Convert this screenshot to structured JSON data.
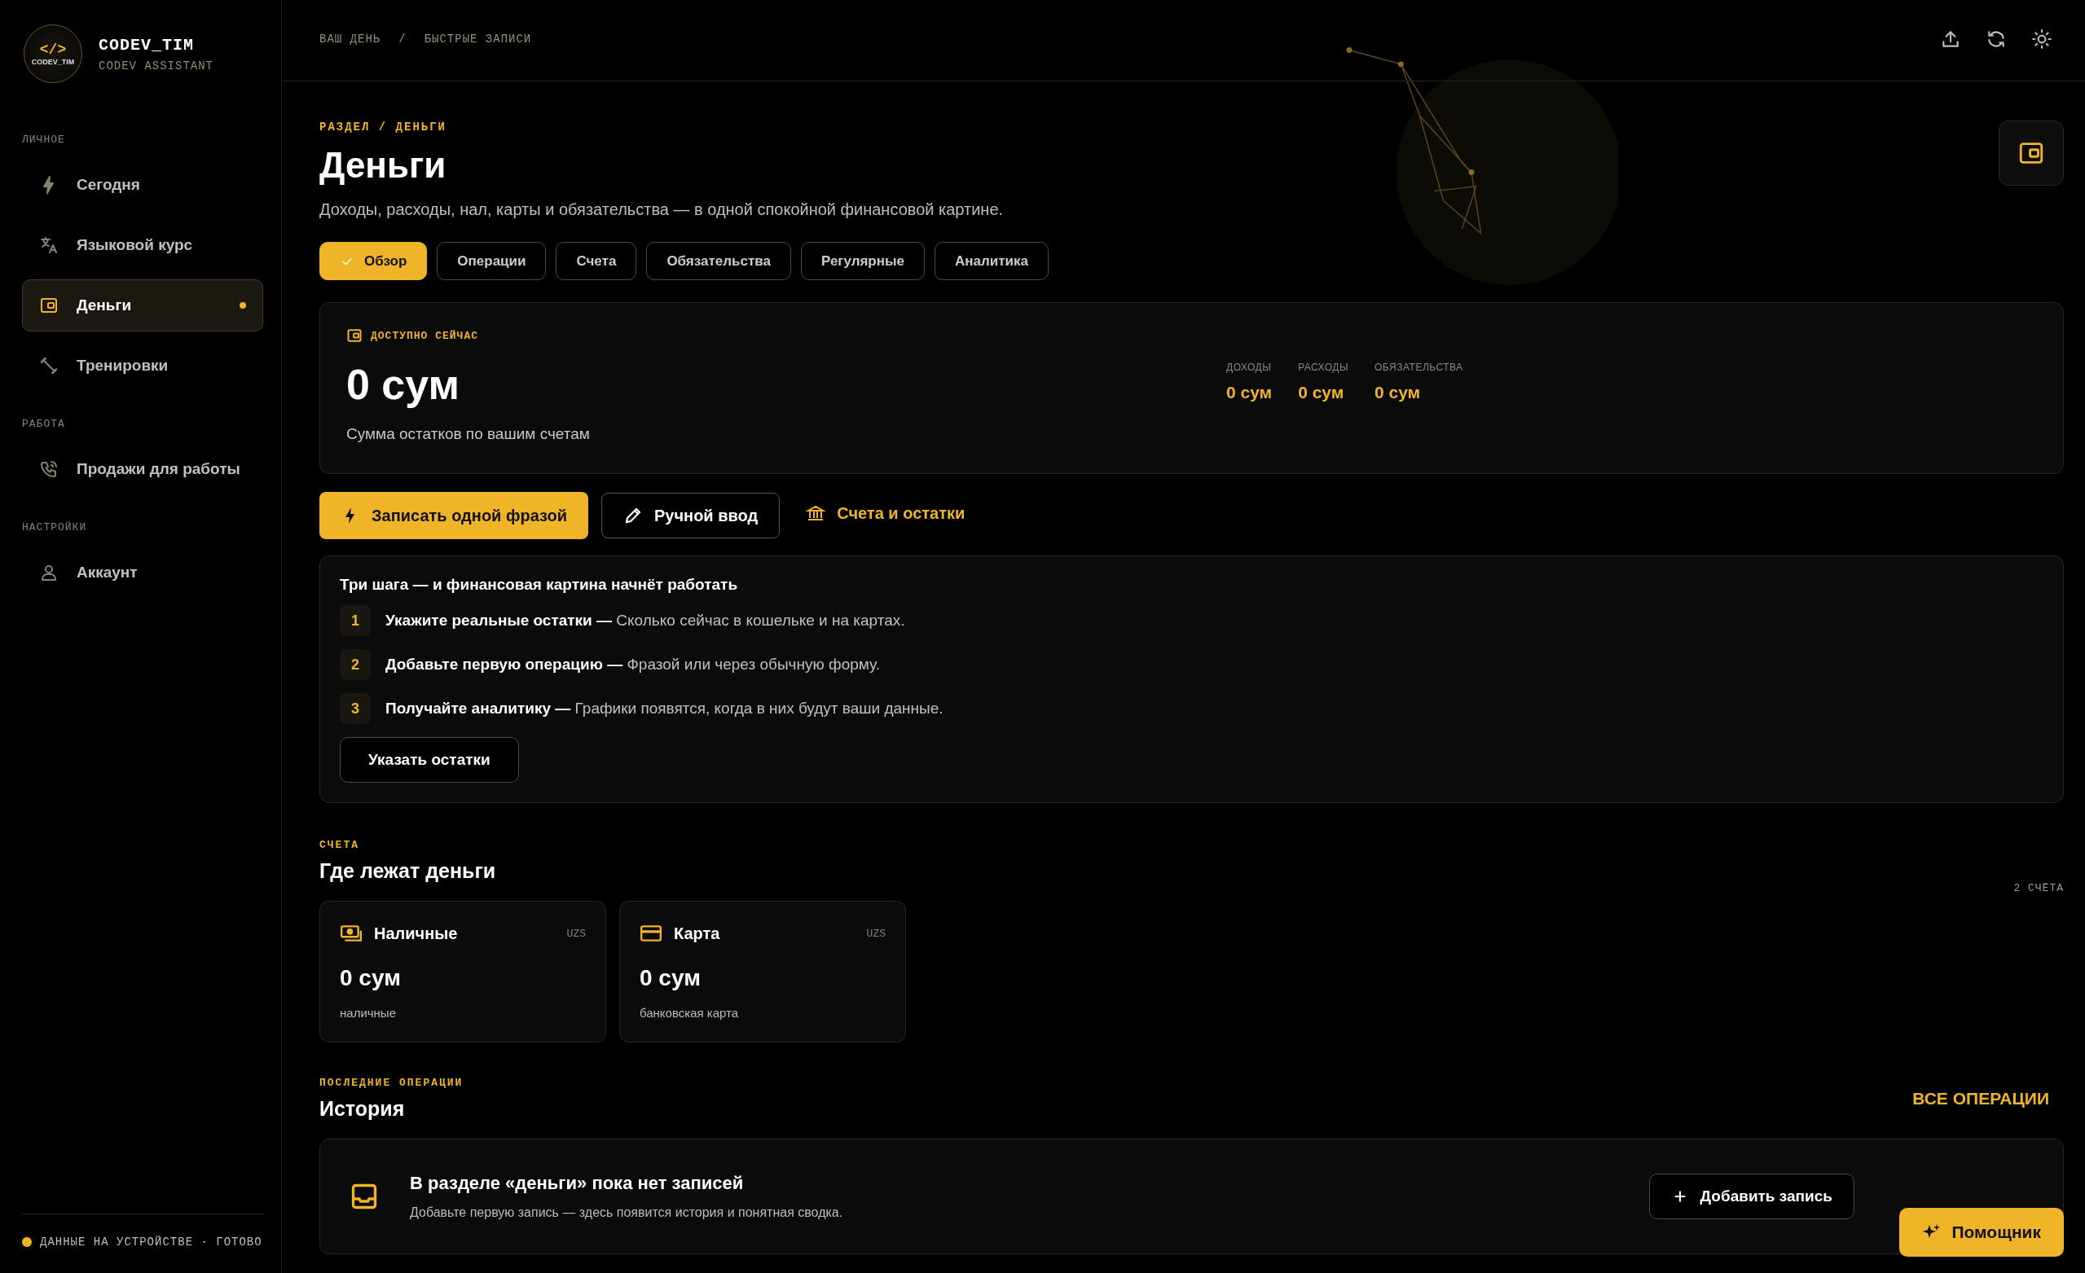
{
  "brand": {
    "name": "CODEV_TIM",
    "subtitle": "CODEV ASSISTANT",
    "logo_text": "CODEV_TIM",
    "logo_glyph": "</>"
  },
  "nav_sections": [
    {
      "label": "ЛИЧНОЕ",
      "items": [
        {
          "label": "Сегодня",
          "selected": false
        },
        {
          "label": "Языковой курс",
          "selected": false
        },
        {
          "label": "Деньги",
          "selected": true
        },
        {
          "label": "Тренировки",
          "selected": false
        }
      ]
    },
    {
      "label": "РАБОТА",
      "items": [
        {
          "label": "Продажи для работы",
          "selected": false
        }
      ]
    },
    {
      "label": "НАСТРОЙКИ",
      "items": [
        {
          "label": "Аккаунт",
          "selected": false
        }
      ]
    }
  ],
  "status": {
    "text": "ДАННЫЕ НА УСТРОЙСТВЕ · ГОТОВО"
  },
  "breadcrumb": [
    "ВАШ ДЕНЬ",
    "БЫСТРЫЕ ЗАПИСИ"
  ],
  "breadcrumb_separator": "/",
  "page": {
    "eyebrow": "РАЗДЕЛ / ДЕНЬГИ",
    "title": "Деньги",
    "subtitle": "Доходы, расходы, нал, карты и обязательства — в одной спокойной финансовой картине."
  },
  "tabs": [
    {
      "label": "Обзор",
      "selected": true
    },
    {
      "label": "Операции",
      "selected": false
    },
    {
      "label": "Счета",
      "selected": false
    },
    {
      "label": "Обязательства",
      "selected": false
    },
    {
      "label": "Регулярные",
      "selected": false
    },
    {
      "label": "Аналитика",
      "selected": false
    }
  ],
  "summary": {
    "label": "ДОСТУПНО СЕЙЧАС",
    "amount": "0 сум",
    "caption": "Сумма остатков по вашим счетам",
    "stats": [
      {
        "label": "ДОХОДЫ",
        "value": "0 сум"
      },
      {
        "label": "РАСХОДЫ",
        "value": "0 сум"
      },
      {
        "label": "ОБЯЗАТЕЛЬСТВА",
        "value": "0 сум"
      }
    ]
  },
  "actions": [
    {
      "label": "Записать одной фразой",
      "kind": "primary"
    },
    {
      "label": "Ручной ввод",
      "kind": "outline"
    },
    {
      "label": "Счета и остатки",
      "kind": "link"
    }
  ],
  "onboarding": {
    "title": "Три шага — и финансовая картина начнёт работать",
    "steps": [
      {
        "number": "1",
        "text": "**Укажите реальные остатки —** Сколько сейчас в кошельке и на картах."
      },
      {
        "number": "2",
        "text": "**Добавьте первую операцию —** Фразой или через обычную форму."
      },
      {
        "number": "3",
        "text": "**Получайте аналитику —** Графики появятся, когда в них будут ваши данные."
      }
    ],
    "button": "Указать остатки"
  },
  "accounts": {
    "eyebrow": "СЧЕТА",
    "title": "Где лежат деньги",
    "count": "2 СЧЁТА",
    "items": [
      {
        "name": "Наличные",
        "currency": "UZS",
        "amount": "0 сум",
        "caption": "наличные",
        "kind": "cash"
      },
      {
        "name": "Карта",
        "currency": "UZS",
        "amount": "0 сум",
        "caption": "банковская карта",
        "kind": "card"
      }
    ]
  },
  "history": {
    "eyebrow": "ПОСЛЕДНИЕ ОПЕРАЦИИ",
    "title": "История",
    "link": "ВСЕ ОПЕРАЦИИ",
    "empty_title": "В разделе «деньги» пока нет записей",
    "empty_text": "Добавьте первую запись — здесь появится история и понятная сводка.",
    "button": "Добавить запись"
  },
  "assistant_button": "Помощник"
}
